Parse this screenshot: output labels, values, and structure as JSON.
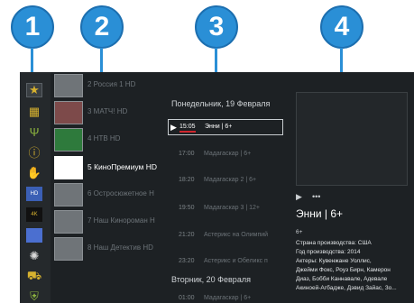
{
  "callouts": [
    "1",
    "2",
    "3",
    "4"
  ],
  "sidebar_icons": [
    "star-icon",
    "grid-icon",
    "antenna-icon",
    "info-icon",
    "thumbs-up-icon",
    "hd-icon",
    "4k-icon",
    "flag-icon",
    "film-reel-icon",
    "cart-icon",
    "shield-icon"
  ],
  "channels": [
    {
      "name": "2 Россия 1 HD"
    },
    {
      "name": "3 МАТЧ! HD"
    },
    {
      "name": "4 НТВ HD"
    },
    {
      "name": "5 КиноПремиум HD"
    },
    {
      "name": "6 Остросюжетное H"
    },
    {
      "name": "7 Наш Кинороман H"
    },
    {
      "name": "8 Наш Детектив HD"
    }
  ],
  "epg": {
    "day1": "Понедельник, 19 Февраля",
    "programs": [
      {
        "time": "15:05",
        "title": "Энни | 6+"
      },
      {
        "time": "17:00",
        "title": "Мадагаскар | 6+"
      },
      {
        "time": "18:20",
        "title": "Мадагаскар 2 | 6+"
      },
      {
        "time": "19:50",
        "title": "Мадагаскар 3 | 12+"
      },
      {
        "time": "21:20",
        "title": "Астерикс на Олимпий"
      },
      {
        "time": "23:20",
        "title": "Астерикс и Обеликс п"
      }
    ],
    "day2": "Вторник, 20 Февраля",
    "next_program": {
      "time": "01:00",
      "title": "Мадагаскар | 6+"
    }
  },
  "detail": {
    "play_icon": "▶",
    "more_icon": "•••",
    "title": "Энни | 6+",
    "rating": "6+",
    "lines": [
      "Страна производства: США",
      "Год производства: 2014",
      "Актеры: Кувенжане Уоллис,",
      "Джейми Фокс, Роуз Бирн, Камерон",
      "Диаз, Бобби Каннавале, Адевале",
      "Акиноей-Агбадже, Дэвид Зайас, Зо..."
    ]
  },
  "colors": {
    "callout_blue": "#2a8fd6",
    "screen_bg": "#1d2124",
    "accent_red": "#d0262e",
    "icon_gold": "#d6b12f"
  }
}
